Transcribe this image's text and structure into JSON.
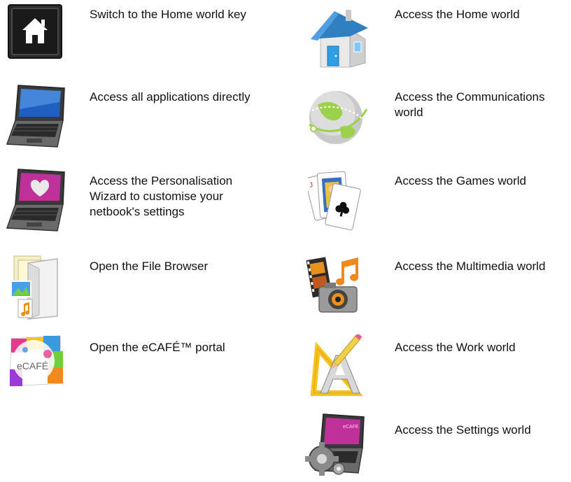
{
  "left_items": [
    {
      "label": "Switch to the Home world key",
      "icon": "home-key-icon"
    },
    {
      "label": "Access all applications directly",
      "icon": "laptop-icon"
    },
    {
      "label": "Access the Personalisation Wizard to customise your netbook's settings",
      "icon": "laptop-heart-icon"
    },
    {
      "label": "Open the File Browser",
      "icon": "file-browser-icon"
    },
    {
      "label": "Open the eCAFÉ™ portal",
      "icon": "ecafe-icon",
      "logo_text": "eCAFÉ"
    }
  ],
  "right_items": [
    {
      "label": "Access the Home world",
      "icon": "house-icon"
    },
    {
      "label": "Access the Communications world",
      "icon": "globe-icon"
    },
    {
      "label": "Access the Games world",
      "icon": "playing-cards-icon"
    },
    {
      "label": "Access the Multimedia world",
      "icon": "multimedia-icon"
    },
    {
      "label": "Access the Work world",
      "icon": "work-tools-icon"
    },
    {
      "label": "Access the Settings world",
      "icon": "settings-laptop-icon"
    }
  ],
  "colors": {
    "text": "#111111",
    "key_background": "#1a1a1a",
    "house_roof": "#2f7fc1",
    "globe_green": "#9bd14b",
    "screen_magenta": "#c0309a"
  }
}
